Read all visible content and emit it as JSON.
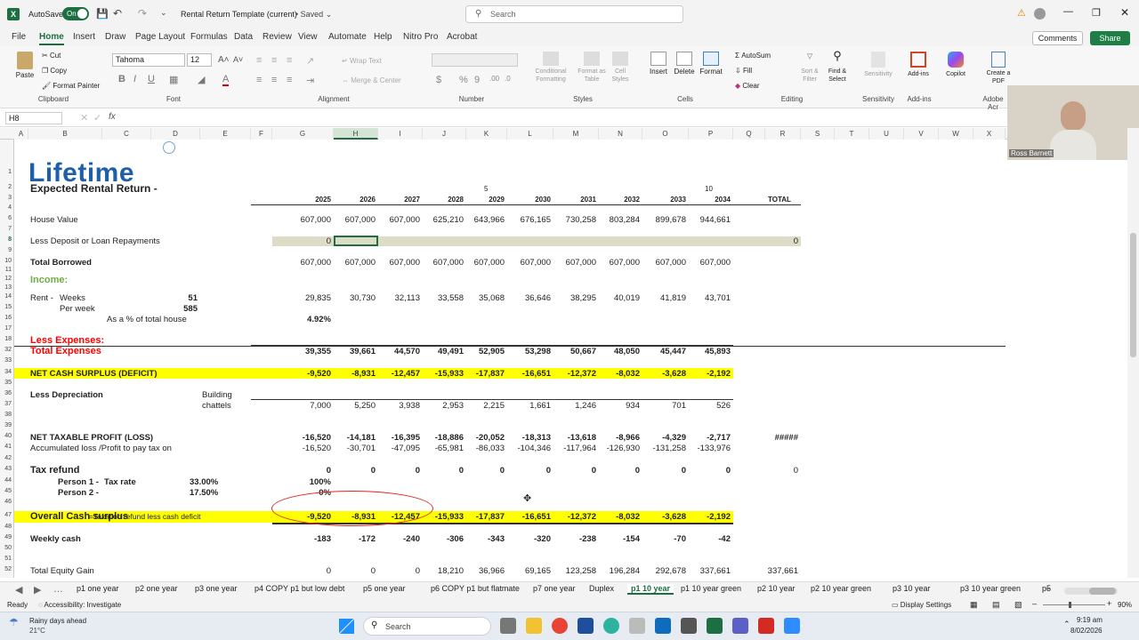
{
  "titlebar": {
    "autosave_label": "AutoSave",
    "autosave_state": "On",
    "doc_title": "Rental Return Template (current)",
    "saved_label": "Saved",
    "search_placeholder": "Search"
  },
  "menu": {
    "tabs": [
      "File",
      "Home",
      "Insert",
      "Draw",
      "Page Layout",
      "Formulas",
      "Data",
      "Review",
      "View",
      "Automate",
      "Help",
      "Nitro Pro",
      "Acrobat"
    ],
    "active": "Home",
    "comments": "Comments",
    "share": "Share"
  },
  "ribbon": {
    "clipboard": {
      "paste": "Paste",
      "cut": "Cut",
      "copy": "Copy",
      "format_painter": "Format Painter",
      "group": "Clipboard"
    },
    "font": {
      "name": "Tahoma",
      "size": "12",
      "group": "Font"
    },
    "alignment": {
      "wrap": "Wrap Text",
      "merge": "Merge & Center",
      "group": "Alignment"
    },
    "number": {
      "group": "Number"
    },
    "styles": {
      "conditional": "Conditional Formatting",
      "format_as_table": "Format as Table",
      "cell_styles": "Cell Styles",
      "group": "Styles"
    },
    "cells": {
      "insert": "Insert",
      "delete": "Delete",
      "format": "Format",
      "group": "Cells"
    },
    "editing": {
      "autosum": "AutoSum",
      "fill": "Fill",
      "clear": "Clear",
      "sort": "Sort & Filter",
      "find": "Find & Select",
      "group": "Editing"
    },
    "sensitivity": {
      "label": "Sensitivity",
      "group": "Sensitivity"
    },
    "addins": {
      "label": "Add-ins",
      "copilot": "Copilot",
      "group": "Add-ins"
    },
    "adobe": {
      "label": "Create a PDF",
      "group": "Adobe Acr"
    }
  },
  "formula_bar": {
    "name_box": "H8",
    "fx": "fx",
    "value": ""
  },
  "video": {
    "name": "Ross Barnett"
  },
  "columns": [
    "A",
    "B",
    "C",
    "D",
    "E",
    "F",
    "G",
    "H",
    "I",
    "J",
    "K",
    "L",
    "M",
    "N",
    "O",
    "P",
    "Q",
    "R",
    "S",
    "T",
    "U",
    "V",
    "W",
    "X"
  ],
  "rows_visible": [
    "1",
    "2",
    "3",
    "4",
    "6",
    "7",
    "8",
    "9",
    "10",
    "11",
    "12",
    "13",
    "14",
    "15",
    "16",
    "17",
    "18",
    "32",
    "33",
    "34",
    "35",
    "36",
    "37",
    "38",
    "39",
    "40",
    "41",
    "42",
    "43",
    "44",
    "45",
    "46",
    "47",
    "48",
    "49",
    "50",
    "51",
    "52"
  ],
  "sheet": {
    "logo": "Lifetime",
    "title": "Expected Rental Return -",
    "year_markers": {
      "k2": "5",
      "p2": "10"
    },
    "years": [
      "2025",
      "2026",
      "2027",
      "2028",
      "2029",
      "2030",
      "2031",
      "2032",
      "2033",
      "2034"
    ],
    "total_header": "TOTAL",
    "house_value": {
      "label": "House Value",
      "values": [
        "607,000",
        "607,000",
        "607,000",
        "625,210",
        "643,966",
        "676,165",
        "730,258",
        "803,284",
        "899,678",
        "944,661"
      ]
    },
    "deposit": {
      "label": "Less Deposit or Loan Repayments",
      "g": "0",
      "total": "0"
    },
    "borrowed": {
      "label": "Total Borrowed",
      "values": [
        "607,000",
        "607,000",
        "607,000",
        "607,000",
        "607,000",
        "607,000",
        "607,000",
        "607,000",
        "607,000",
        "607,000"
      ]
    },
    "income_label": "Income:",
    "rent": {
      "label": "Rent -",
      "weeks_label": "Weeks",
      "weeks": "51",
      "values": [
        "29,835",
        "30,730",
        "32,113",
        "33,558",
        "35,068",
        "36,646",
        "38,295",
        "40,019",
        "41,819",
        "43,701"
      ]
    },
    "per_week": {
      "label": "Per week",
      "value": "585"
    },
    "pct_house": {
      "label": "As a % of total house",
      "value": "4.92%"
    },
    "expenses_label": "Less Expenses:",
    "total_expenses": {
      "label": "Total Expenses",
      "values": [
        "39,355",
        "39,661",
        "44,570",
        "49,491",
        "52,905",
        "53,298",
        "50,667",
        "48,050",
        "45,447",
        "45,893"
      ]
    },
    "net_cash": {
      "label": "NET CASH SURPLUS (DEFICIT)",
      "values": [
        "-9,520",
        "-8,931",
        "-12,457",
        "-15,933",
        "-17,837",
        "-16,651",
        "-12,372",
        "-8,032",
        "-3,628",
        "-2,192"
      ]
    },
    "depreciation": {
      "label": "Less Depreciation",
      "building": "Building",
      "chattels": "chattels",
      "values": [
        "7,000",
        "5,250",
        "3,938",
        "2,953",
        "2,215",
        "1,661",
        "1,246",
        "934",
        "701",
        "526"
      ]
    },
    "taxable": {
      "label": "NET TAXABLE PROFIT (LOSS)",
      "values": [
        "-16,520",
        "-14,181",
        "-16,395",
        "-18,886",
        "-20,052",
        "-18,313",
        "-13,618",
        "-8,966",
        "-4,329",
        "-2,717"
      ],
      "total": "#####"
    },
    "accum": {
      "label": "Accumulated loss /Profit to pay tax on",
      "values": [
        "-16,520",
        "-30,701",
        "-47,095",
        "-65,981",
        "-86,033",
        "-104,346",
        "-117,964",
        "-126,930",
        "-131,258",
        "-133,976"
      ]
    },
    "tax_refund": {
      "label": "Tax refund",
      "values": [
        "0",
        "0",
        "0",
        "0",
        "0",
        "0",
        "0",
        "0",
        "0",
        "0"
      ],
      "total": "0"
    },
    "person1": {
      "label": "Person 1 -",
      "rate_label": "Tax rate",
      "rate": "33.00%",
      "share": "100%"
    },
    "person2": {
      "label": "Person 2 -",
      "rate": "17.50%",
      "share": "0%"
    },
    "overall": {
      "label": "Overall Cash surplus",
      "formula": "=Taxation refund less cash deficit",
      "values": [
        "-9,520",
        "-8,931",
        "-12,457",
        "-15,933",
        "-17,837",
        "-16,651",
        "-12,372",
        "-8,032",
        "-3,628",
        "-2,192"
      ]
    },
    "weekly": {
      "label": "Weekly cash",
      "values": [
        "-183",
        "-172",
        "-240",
        "-306",
        "-343",
        "-320",
        "-238",
        "-154",
        "-70",
        "-42"
      ]
    },
    "equity": {
      "label": "Total Equity Gain",
      "values": [
        "0",
        "0",
        "0",
        "18,210",
        "36,966",
        "69,165",
        "123,258",
        "196,284",
        "292,678",
        "337,661"
      ],
      "total": "337,661"
    }
  },
  "sheet_tabs": [
    "p1 one year",
    "p2 one year",
    "p3 one year",
    "p4 COPY p1 but low debt",
    "p5 one year",
    "p6 COPY p1 but flatmate",
    "p7 one year",
    "Duplex",
    "p1 10 year",
    "p1 10 year green",
    "p2 10 year",
    "p2 10 year green",
    "p3 10 year",
    "p3 10 year green",
    "p5"
  ],
  "active_sheet": "p1 10 year",
  "status": {
    "ready": "Ready",
    "accessibility": "Accessibility: Investigate",
    "display": "Display Settings",
    "zoom": "90%"
  },
  "taskbar": {
    "weather": "Rainy days ahead",
    "temp": "21°C",
    "search": "Search",
    "time": "9:19 am",
    "date": "8/02/2026"
  },
  "colors": {
    "excel_green": "#217346",
    "highlight": "#ffff00",
    "income_green": "#70ad47",
    "expense_red": "#ff0000",
    "logo_blue": "#1f5fa8",
    "share_green": "#1e7e45"
  }
}
